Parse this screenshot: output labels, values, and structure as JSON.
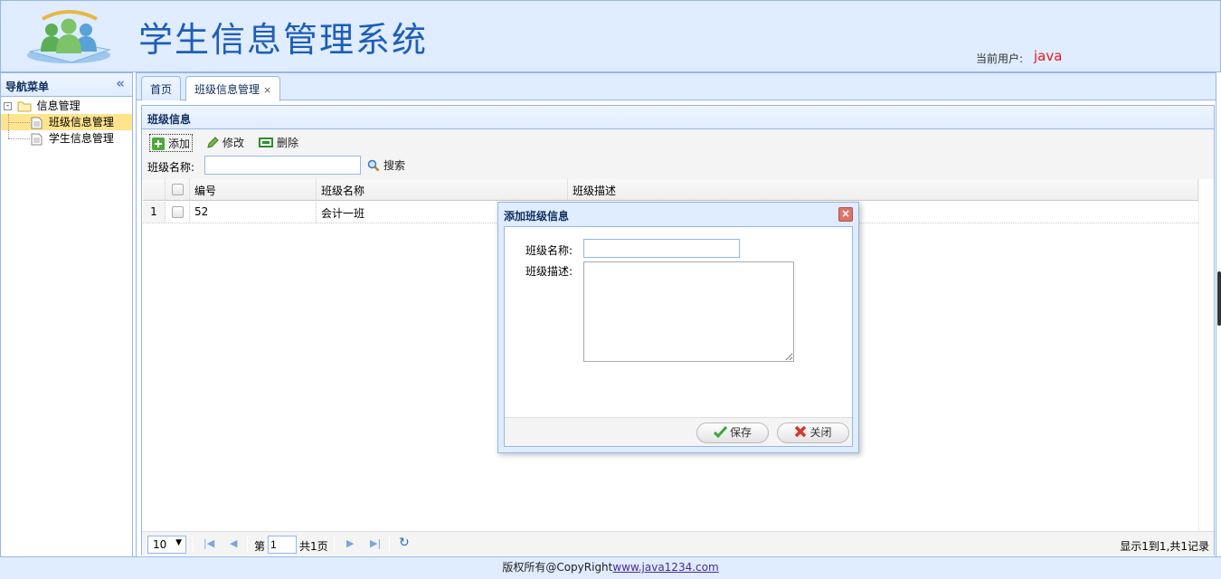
{
  "header": {
    "title": "学生信息管理系统",
    "user_label": "当前用户:",
    "user_name": "java"
  },
  "nav": {
    "title": "导航菜单",
    "collapse_icon": "double-chevron-left-icon",
    "root": {
      "label": "信息管理",
      "icon": "folder-icon"
    },
    "items": [
      {
        "label": "班级信息管理",
        "icon": "file-icon",
        "selected": true
      },
      {
        "label": "学生信息管理",
        "icon": "file-icon",
        "selected": false
      }
    ]
  },
  "tabs": [
    {
      "label": "首页",
      "active": false
    },
    {
      "label": "班级信息管理",
      "active": true,
      "close": "×"
    }
  ],
  "panel": {
    "title": "班级信息"
  },
  "toolbar": {
    "add_label": "添加",
    "edit_label": "修改",
    "delete_label": "删除",
    "search_label": "班级名称:",
    "search_value": "",
    "search_button": "搜索"
  },
  "grid": {
    "columns": [
      "编号",
      "班级名称",
      "班级描述"
    ],
    "rows": [
      {
        "num": "1",
        "id": "52",
        "name": "会计一班",
        "desc": ""
      }
    ]
  },
  "pager": {
    "page_size": "10",
    "page_prefix": "第",
    "page_value": "1",
    "page_total": "共1页",
    "summary": "显示1到1,共1记录"
  },
  "dialog": {
    "title": "添加班级信息",
    "close": "×",
    "name_label": "班级名称:",
    "desc_label": "班级描述:",
    "save_label": "保存",
    "close_label": "关闭"
  },
  "footer": {
    "text": "版权所有@CopyRight",
    "link": "www.java1234.com"
  },
  "colors": {
    "header_bg": "#e0ecff",
    "border": "#95b8e7",
    "title": "#1d5eb8",
    "user": "#e61b1b",
    "selected": "#ffe48d"
  }
}
